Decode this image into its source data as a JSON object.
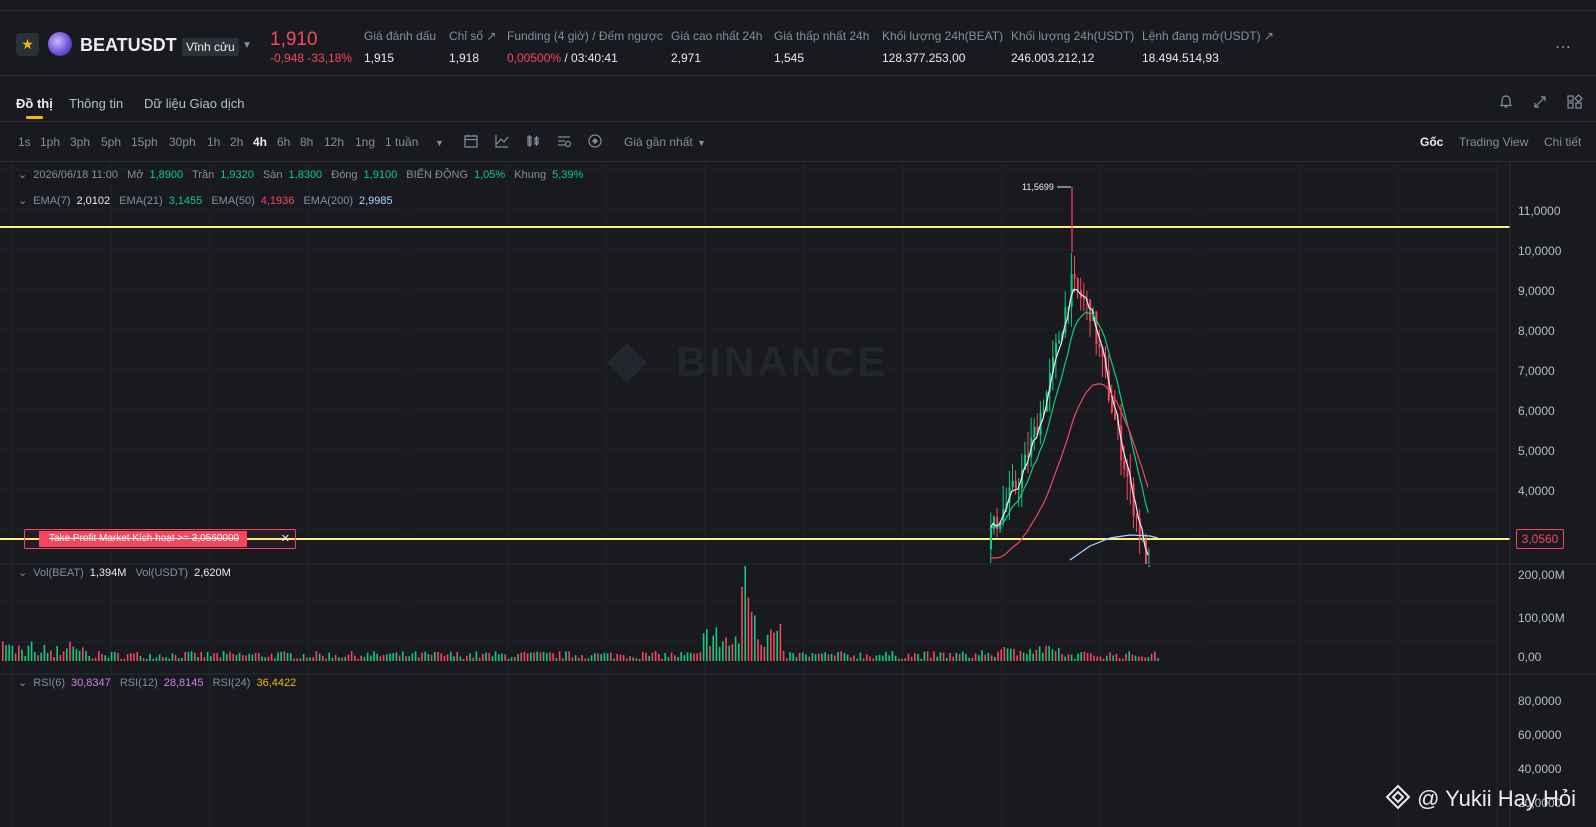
{
  "header": {
    "symbol": "BEATUSDT",
    "contract_type": "Vĩnh cửu",
    "last_price": "1,910",
    "change": "-0,948 -33,18%",
    "stats": [
      {
        "label": "Giá đánh dấu",
        "value": "1,915"
      },
      {
        "label": "Chỉ số ↗",
        "value": "1,918"
      },
      {
        "label": "Funding (4 giờ) / Đếm ngược",
        "value_red": "0,00500%",
        "value_rest": " / 03:40:41"
      },
      {
        "label": "Giá cao nhất 24h",
        "value": "2,971"
      },
      {
        "label": "Giá thấp nhất 24h",
        "value": "1,545"
      },
      {
        "label": "Khối lượng 24h(BEAT)",
        "value": "128.377.253,00"
      },
      {
        "label": "Khối lượng 24h(USDT)",
        "value": "246.003.212,12"
      },
      {
        "label": "Lệnh đang mở(USDT) ↗",
        "value": "18.494.514,93"
      }
    ],
    "more_icon": "more-dots-icon",
    "star_icon": "star-icon"
  },
  "tabs": {
    "items": [
      "Đồ thị",
      "Thông tin",
      "Dữ liệu Giao dịch"
    ],
    "icons": [
      "bell-icon",
      "expand-icon",
      "layout-grid-icon"
    ]
  },
  "toolbar": {
    "timeframes": [
      "1s",
      "1ph",
      "3ph",
      "5ph",
      "15ph",
      "30ph",
      "1h",
      "2h",
      "4h",
      "6h",
      "8h",
      "12h",
      "1ng",
      "1 tuần"
    ],
    "active_timeframe": "4h",
    "price_source": "Giá gần nhất",
    "views": [
      "Gốc",
      "Trading View",
      "Chi tiết"
    ],
    "active_view": "Gốc"
  },
  "candle_info": {
    "date": "2026/06/18 11:00",
    "open_label": "Mở",
    "open": "1,8900",
    "high_label": "Trần",
    "high": "1,9320",
    "low_label": "Sàn",
    "low": "1,8300",
    "close_label": "Đóng",
    "close": "1,9100",
    "change_label": "BIẾN ĐỘNG",
    "change": "1,05%",
    "range_label": "Khung",
    "range": "5,39%"
  },
  "ema": {
    "ema7_label": "EMA(7)",
    "ema7": "2,0102",
    "ema21_label": "EMA(21)",
    "ema21": "3,1455",
    "ema50_label": "EMA(50)",
    "ema50": "4,1936",
    "ema200_label": "EMA(200)",
    "ema200": "2,9985"
  },
  "volume": {
    "beat_label": "Vol(BEAT)",
    "beat": "1,394M",
    "usdt_label": "Vol(USDT)",
    "usdt": "2,620M"
  },
  "rsi": {
    "rsi6_label": "RSI(6)",
    "rsi6": "30,8347",
    "rsi12_label": "RSI(12)",
    "rsi12": "28,8145",
    "rsi24_label": "RSI(24)",
    "rsi24": "36,4422"
  },
  "price_axis": [
    "11,0000",
    "10,0000",
    "9,0000",
    "8,0000",
    "7,0000",
    "6,0000",
    "5,0000",
    "4,0000"
  ],
  "volume_axis": [
    "200,00M",
    "100,00M",
    "0,00"
  ],
  "rsi_axis": [
    "80,0000",
    "60,0000",
    "40,0000",
    "20,0000"
  ],
  "peak_label": "11,5699",
  "watermark": "BINANCE",
  "take_profit": {
    "label": "Take Profit Market Kích hoạt >= 3,0560000",
    "price_tag": "3,0560"
  },
  "credit": "@ Yukii Hay Hỏi",
  "colors": {
    "bg": "#181a20",
    "up": "#0ecb81",
    "down": "#f6465d",
    "accent": "#f0b90b",
    "hline": "#fcf07a"
  }
}
